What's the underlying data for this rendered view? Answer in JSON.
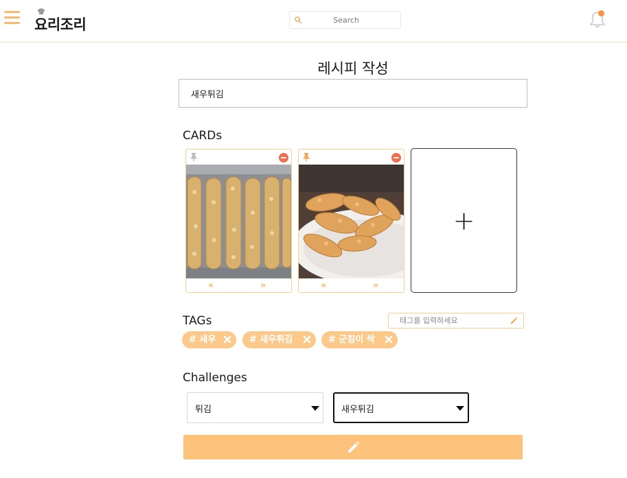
{
  "header": {
    "app_name": "요리조리",
    "search": {
      "placeholder": "Search"
    }
  },
  "main": {
    "page_title": "레시피 작성",
    "recipe_title_value": "새우튀김",
    "sections": {
      "cards_label": "CARDs",
      "tags_label": "TAGs",
      "challenges_label": "Challenges"
    },
    "cards": [
      {
        "prev_label": "«",
        "next_label": "»",
        "image": "fried-shrimp-rows-photo"
      },
      {
        "prev_label": "«",
        "next_label": "»",
        "image": "fried-shrimp-plate-photo"
      }
    ],
    "add_card_label": "+",
    "tag_input_placeholder": "태그를 입력하세요",
    "tags": [
      {
        "label": "# 새우"
      },
      {
        "label": "# 새우튀김"
      },
      {
        "label": "# 군침이 싹"
      }
    ],
    "challenges": {
      "category_selected": "튀김",
      "challenge_selected": "새우튀김"
    }
  },
  "colors": {
    "accent": "#fbb86a",
    "tag_bg": "#fdc98a",
    "submit_bg": "#fdc37c",
    "remove_red": "#f26d4f",
    "notification_dot": "#fb923c"
  }
}
